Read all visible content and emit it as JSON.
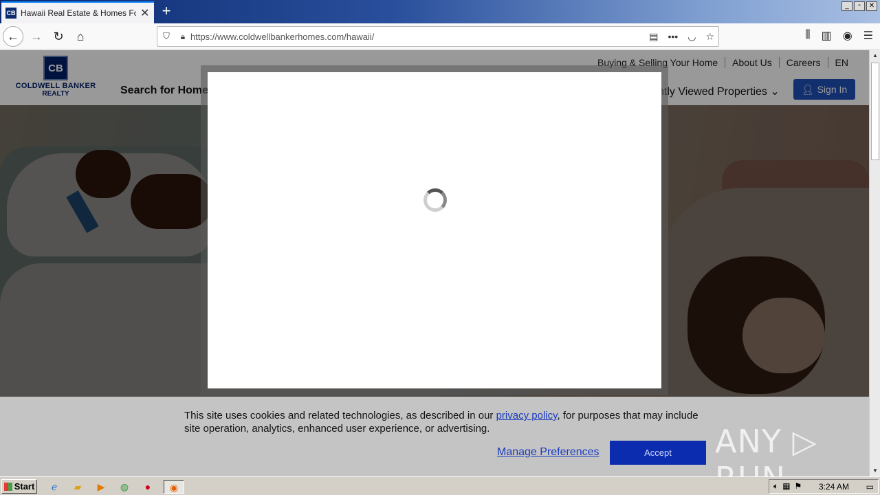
{
  "browser": {
    "tab_title": "Hawaii Real Estate & Homes For Sale",
    "tab_favicon": "CB",
    "tab_close": "✕",
    "new_tab": "+",
    "url_domain": "https://www.coldwellbankerhomes.com",
    "url_path": "/hawaii/",
    "window_controls": [
      "_",
      "▫",
      "✕"
    ]
  },
  "site": {
    "logo_mark": "CB",
    "brand_line1": "COLDWELL BANKER",
    "brand_line2": "REALTY",
    "top_links": [
      "Buying & Selling Your Home",
      "About Us",
      "Careers",
      "EN"
    ],
    "nav_left": "Search for Homes",
    "nav_right": "ntly Viewed Properties",
    "signin_label": "Sign In"
  },
  "cookie_banner": {
    "text_before": "This site uses cookies and related technologies, as described in our ",
    "privacy_link": "privacy policy",
    "text_after": ", for purposes that may include site operation, analytics, enhanced user experience, or advertising.",
    "manage_label": "Manage Preferences",
    "accept_label": "Accept"
  },
  "watermark": "ANY ▷ RUN",
  "taskbar": {
    "start_label": "Start",
    "clock": "3:24 AM"
  },
  "icons": [
    "back-arrow-icon",
    "forward-arrow-icon",
    "reload-icon",
    "home-icon",
    "shield-icon",
    "lock-icon",
    "reader-icon",
    "more-icon",
    "pocket-icon",
    "star-icon",
    "library-icon",
    "sidebar-icon",
    "account-icon",
    "menu-icon",
    "user-icon",
    "chevron-down-icon",
    "spinner-icon"
  ]
}
